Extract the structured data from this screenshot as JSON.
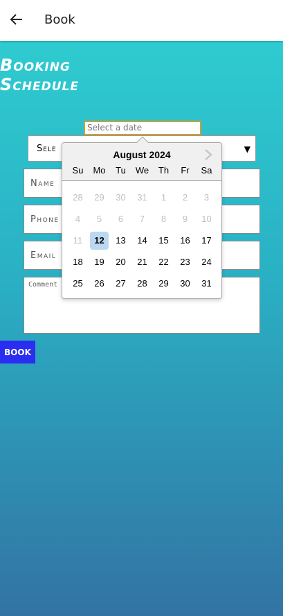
{
  "appbar": {
    "title": "Book"
  },
  "page": {
    "title_line1": "Booking",
    "title_line2": "Schedule"
  },
  "date_input": {
    "placeholder": "Select a date"
  },
  "form": {
    "select_label": "Sele",
    "name_placeholder": "Name",
    "phone_placeholder": "Phone",
    "email_placeholder": "Email",
    "comment_placeholder": "Comment",
    "book_label": "BOOK"
  },
  "datepicker": {
    "month_label": "August 2024",
    "weekdays": [
      "Su",
      "Mo",
      "Tu",
      "We",
      "Th",
      "Fr",
      "Sa"
    ],
    "weeks": [
      [
        {
          "d": "28",
          "m": true
        },
        {
          "d": "29",
          "m": true
        },
        {
          "d": "30",
          "m": true
        },
        {
          "d": "31",
          "m": true
        },
        {
          "d": "1",
          "m": true
        },
        {
          "d": "2",
          "m": true
        },
        {
          "d": "3",
          "m": true
        }
      ],
      [
        {
          "d": "4",
          "m": true
        },
        {
          "d": "5",
          "m": true
        },
        {
          "d": "6",
          "m": true
        },
        {
          "d": "7",
          "m": true
        },
        {
          "d": "8",
          "m": true
        },
        {
          "d": "9",
          "m": true
        },
        {
          "d": "10",
          "m": true
        }
      ],
      [
        {
          "d": "11",
          "m": true
        },
        {
          "d": "12",
          "s": true
        },
        {
          "d": "13"
        },
        {
          "d": "14"
        },
        {
          "d": "15"
        },
        {
          "d": "16"
        },
        {
          "d": "17"
        }
      ],
      [
        {
          "d": "18"
        },
        {
          "d": "19"
        },
        {
          "d": "20"
        },
        {
          "d": "21"
        },
        {
          "d": "22"
        },
        {
          "d": "23"
        },
        {
          "d": "24"
        }
      ],
      [
        {
          "d": "25"
        },
        {
          "d": "26"
        },
        {
          "d": "27"
        },
        {
          "d": "28"
        },
        {
          "d": "29"
        },
        {
          "d": "30"
        },
        {
          "d": "31"
        }
      ]
    ]
  },
  "colors": {
    "accent": "#2a2ef0",
    "selected_day": "#bcd7f0",
    "input_border": "#d4a02b"
  }
}
